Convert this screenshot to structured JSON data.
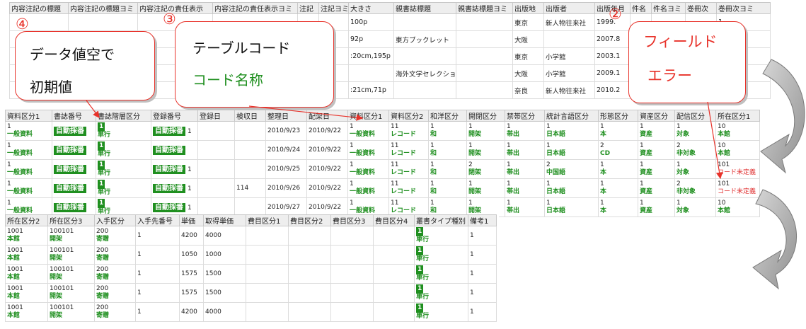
{
  "table1": {
    "headers": [
      "内容注記の標題",
      "内容注記の標題ヨミ",
      "内容注記の責任表示",
      "内容注記の責任表示ヨミ",
      "注記",
      "注記ヨミ",
      "大きさ",
      "親書誌標題",
      "親書誌標題ヨミ",
      "出版地",
      "出版者",
      "出版年月",
      "件名",
      "件名ヨミ",
      "巻冊次",
      "巻冊次ヨミ"
    ],
    "rows": [
      [
        "",
        "",
        "",
        "",
        "",
        "",
        "100p",
        "",
        "",
        "東京",
        "新人物往来社",
        "1999.",
        "",
        "",
        "",
        "1"
      ],
      [
        "",
        "",
        "",
        "",
        "",
        "",
        "92p",
        "東方ブックレット",
        "",
        "大阪",
        "",
        "2007.8",
        "",
        "",
        "",
        "1"
      ],
      [
        "",
        "",
        "",
        "",
        "",
        "",
        ":20cm,195p",
        "",
        "",
        "東京",
        "小学館",
        "2003.1",
        "",
        "",
        "",
        "10"
      ],
      [
        "",
        "",
        "",
        "",
        "",
        "",
        "",
        "海外文学セレクション",
        "",
        "大阪",
        "小学館",
        "2009.1",
        "",
        "",
        "",
        "10"
      ],
      [
        "",
        "",
        "",
        "",
        "",
        "",
        ":21cm,71p",
        "",
        "",
        "奈良",
        "新人物往来社",
        "2010.2",
        "",
        "",
        "",
        "1"
      ]
    ]
  },
  "table2": {
    "headers": [
      "資料区分1",
      "書誌番号",
      "書誌階層区分",
      "登録番号",
      "登録日",
      "検収日",
      "整理日",
      "配架日",
      "資料区分1",
      "資料区分2",
      "和洋区分",
      "開閉区分",
      "禁帯区分",
      "統計言語区分",
      "形態区分",
      "資産区分",
      "配信区分",
      "所在区分1"
    ],
    "auto_label": "自動採番",
    "rows": [
      {
        "c0": [
          "1",
          "一般資料"
        ],
        "c2": [
          "1",
          "単行"
        ],
        "reg": "1",
        "kenshu": "",
        "seiri": "2010/9/23",
        "haika": "2010/9/22",
        "c8": [
          "1",
          "一般資料"
        ],
        "c9": [
          "11",
          "レコード"
        ],
        "c10": [
          "1",
          "和"
        ],
        "c11": [
          "1",
          "開架"
        ],
        "c12": [
          "1",
          "帯出"
        ],
        "c13": [
          "1",
          "日本語"
        ],
        "c14": [
          "1",
          "本"
        ],
        "c15": [
          "1",
          "資産"
        ],
        "c16": [
          "1",
          "対象"
        ],
        "c17": [
          "10",
          "本館"
        ],
        "c17red": false
      },
      {
        "c0": [
          "1",
          "一般資料"
        ],
        "c2": [
          "1",
          "単行"
        ],
        "reg": "",
        "kenshu": "",
        "seiri": "2010/9/24",
        "haika": "2010/9/22",
        "c8": [
          "1",
          "一般資料"
        ],
        "c9": [
          "11",
          "レコード"
        ],
        "c10": [
          "1",
          "和"
        ],
        "c11": [
          "1",
          "開架"
        ],
        "c12": [
          "1",
          "帯出"
        ],
        "c13": [
          "1",
          "日本語"
        ],
        "c14": [
          "2",
          "CD"
        ],
        "c15": [
          "1",
          "資産"
        ],
        "c16": [
          "2",
          "非対象"
        ],
        "c17": [
          "10",
          "本館"
        ],
        "c17red": false
      },
      {
        "c0": [
          "1",
          "一般資料"
        ],
        "c2": [
          "1",
          "単行"
        ],
        "reg": "1",
        "kenshu": "",
        "seiri": "2010/9/25",
        "haika": "2010/9/22",
        "c8": [
          "1",
          "一般資料"
        ],
        "c9": [
          "11",
          "レコード"
        ],
        "c10": [
          "1",
          "和"
        ],
        "c11": [
          "2",
          "閉架"
        ],
        "c12": [
          "1",
          "帯出"
        ],
        "c13": [
          "2",
          "中国語"
        ],
        "c14": [
          "1",
          "本"
        ],
        "c15": [
          "1",
          "資産"
        ],
        "c16": [
          "1",
          "対象"
        ],
        "c17": [
          "101",
          "コード未定義"
        ],
        "c17red": true
      },
      {
        "c0": [
          "1",
          "一般資料"
        ],
        "c2": [
          "1",
          "単行"
        ],
        "reg": "1",
        "kenshu": "114",
        "seiri": "2010/9/26",
        "haika": "2010/9/22",
        "c8": [
          "1",
          "一般資料"
        ],
        "c9": [
          "11",
          "レコード"
        ],
        "c10": [
          "1",
          "和"
        ],
        "c11": [
          "1",
          "開架"
        ],
        "c12": [
          "1",
          "帯出"
        ],
        "c13": [
          "1",
          "日本語"
        ],
        "c14": [
          "1",
          "本"
        ],
        "c15": [
          "1",
          "資産"
        ],
        "c16": [
          "2",
          "非対象"
        ],
        "c17": [
          "101",
          "コード未定義"
        ],
        "c17red": true
      },
      {
        "c0": [
          "1",
          "一般資料"
        ],
        "c2": [
          "1",
          "単行"
        ],
        "reg": "1",
        "kenshu": "",
        "seiri": "2010/9/27",
        "haika": "2010/9/22",
        "c8": [
          "1",
          "一般資料"
        ],
        "c9": [
          "11",
          "レコード"
        ],
        "c10": [
          "1",
          "和"
        ],
        "c11": [
          "1",
          "開架"
        ],
        "c12": [
          "1",
          "帯出"
        ],
        "c13": [
          "1",
          "日本語"
        ],
        "c14": [
          "1",
          "本"
        ],
        "c15": [
          "1",
          "資産"
        ],
        "c16": [
          "1",
          "対象"
        ],
        "c17": [
          "10",
          "本館"
        ],
        "c17red": false
      }
    ]
  },
  "table3": {
    "headers": [
      "所在区分2",
      "所在区分3",
      "入手区分",
      "入手先番号",
      "単価",
      "取得単価",
      "費目区分1",
      "費目区分2",
      "費目区分3",
      "費目区分4",
      "叢書タイプ種別",
      "備考1"
    ],
    "rows": [
      {
        "l2": [
          "1001",
          "本館"
        ],
        "l3": [
          "100101",
          "開架"
        ],
        "nyu": [
          "200",
          "寄贈"
        ],
        "saki": "1",
        "tanka": "4200",
        "shutoku": "4000",
        "sosho": [
          "1",
          "単行"
        ],
        "biko": "1"
      },
      {
        "l2": [
          "1001",
          "本館"
        ],
        "l3": [
          "100101",
          "開架"
        ],
        "nyu": [
          "200",
          "寄贈"
        ],
        "saki": "1",
        "tanka": "1050",
        "shutoku": "1000",
        "sosho": [
          "1",
          "単行"
        ],
        "biko": "1"
      },
      {
        "l2": [
          "1001",
          "本館"
        ],
        "l3": [
          "100101",
          "開架"
        ],
        "nyu": [
          "200",
          "寄贈"
        ],
        "saki": "1",
        "tanka": "1575",
        "shutoku": "1500",
        "sosho": [
          "1",
          "単行"
        ],
        "biko": "1"
      },
      {
        "l2": [
          "1001",
          "本館"
        ],
        "l3": [
          "100101",
          "開架"
        ],
        "nyu": [
          "200",
          "寄贈"
        ],
        "saki": "1",
        "tanka": "1575",
        "shutoku": "1500",
        "sosho": [
          "1",
          "単行"
        ],
        "biko": "1"
      },
      {
        "l2": [
          "1001",
          "本館"
        ],
        "l3": [
          "100101",
          "開架"
        ],
        "nyu": [
          "200",
          "寄贈"
        ],
        "saki": "1",
        "tanka": "4200",
        "shutoku": "4000",
        "sosho": [
          "1",
          "単行"
        ],
        "biko": "1"
      }
    ]
  },
  "annotations": {
    "n4": "④",
    "n3": "③",
    "n2": "②",
    "c4_line1": "データ値空で",
    "c4_line2": "初期値",
    "c3_line1": "テーブルコード",
    "c3_line2": "コード名称",
    "c2_line1": "フィールド",
    "c2_line2": "エラー"
  },
  "colors": {
    "accent_red": "#e8322a",
    "code_green": "#1f8f1f",
    "header_bg": "#eeeeee"
  }
}
